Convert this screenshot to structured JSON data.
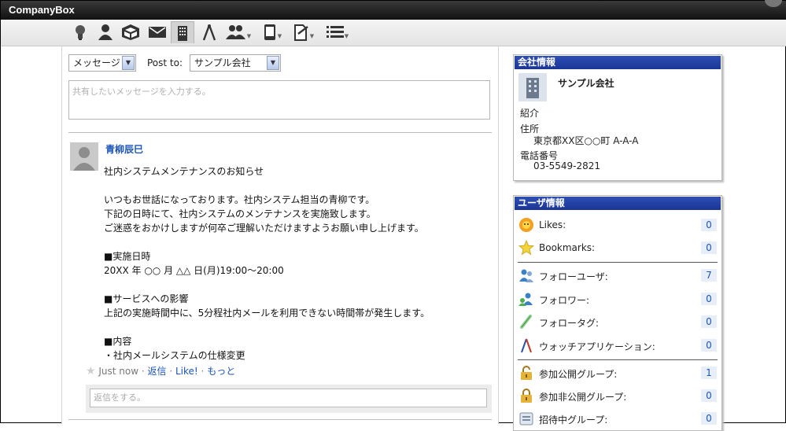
{
  "app": {
    "title": "CompanyBox"
  },
  "toolbar": {
    "items": [
      {
        "name": "idea-icon"
      },
      {
        "name": "user-icon"
      },
      {
        "name": "box-icon"
      },
      {
        "name": "mail-icon"
      },
      {
        "name": "company-icon",
        "active": true
      },
      {
        "name": "compass-icon"
      },
      {
        "name": "group-icon",
        "dropdown": true
      },
      {
        "name": "device-icon",
        "dropdown": true
      },
      {
        "name": "document-icon",
        "dropdown": true
      },
      {
        "name": "list-icon",
        "dropdown": true
      }
    ]
  },
  "composer": {
    "type_select": "メッセージ",
    "post_to_label": "Post to:",
    "post_to_select": "サンプル会社",
    "message_placeholder": "共有したいメッセージを入力する。"
  },
  "post": {
    "author": "青柳辰巳",
    "lines": [
      "社内システムメンテナンスのお知らせ",
      "",
      "いつもお世話になっております。社内システム担当の青柳です。",
      "下記の日時にて、社内システムのメンテナンスを実施致します。",
      "ご迷惑をおかけしますが何卒ご理解いただけますようお願い申し上げます。",
      "",
      "■実施日時",
      "20XX 年 ○○ 月 △△ 日(月)19:00～20:00",
      "",
      "■サービスへの影響",
      "上記の実施時間中に、5分程社内メールを利用できない時間帯が発生します。",
      "",
      "■内容",
      "・社内メールシステムの仕様変更"
    ],
    "time": "Just now",
    "actions": {
      "reply": "返信",
      "like": "Like!",
      "more": "もっと"
    },
    "reply_placeholder": "返信をする。"
  },
  "company_info": {
    "header": "会社情報",
    "name": "サンプル会社",
    "intro_label": "紹介",
    "address_label": "住所",
    "address": "東京都XX区○○町 A-A-A",
    "phone_label": "電話番号",
    "phone": "03-5549-2821"
  },
  "user_info": {
    "header": "ユーザ情報",
    "stats": [
      {
        "icon": "likes-icon",
        "label": "Likes:",
        "count": "0"
      },
      {
        "icon": "bookmark-star-icon",
        "label": "Bookmarks:",
        "count": "0"
      },
      {
        "icon": "follow-users-icon",
        "label": "フォローユーザ:",
        "count": "7"
      },
      {
        "icon": "followers-icon",
        "label": "フォロワー:",
        "count": "0"
      },
      {
        "icon": "follow-tags-icon",
        "label": "フォロータグ:",
        "count": "0"
      },
      {
        "icon": "watch-apps-icon",
        "label": "ウォッチアプリケーション:",
        "count": "0"
      },
      {
        "icon": "public-group-lock-icon",
        "label": "参加公開グループ:",
        "count": "1"
      },
      {
        "icon": "private-group-lock-icon",
        "label": "参加非公開グループ:",
        "count": "0"
      },
      {
        "icon": "invited-group-icon",
        "label": "招待中グループ:",
        "count": "0"
      }
    ]
  }
}
